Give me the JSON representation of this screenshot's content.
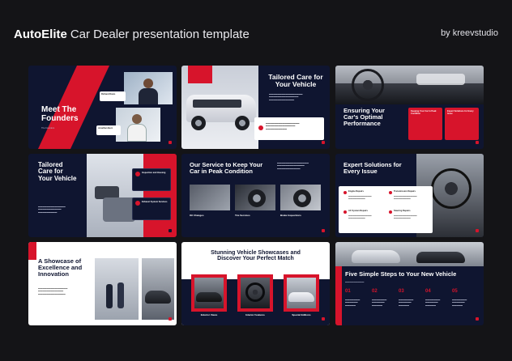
{
  "header": {
    "brand": "AutoElite",
    "subtitle": "Car Dealer presentation template",
    "credit": "by kreevstudio"
  },
  "slides": {
    "founders": {
      "title_line1": "Meet The",
      "title_line2": "Founders",
      "subtitle": "The Founders",
      "name1": "Richard Davis",
      "name2": "Jonathan Bern"
    },
    "tailored": {
      "title_line1": "Tailored Care for",
      "title_line2": "Your Vehicle"
    },
    "ensuring": {
      "title_line1": "Ensuring Your",
      "title_line2": "Car's Optimal",
      "title_line3": "Performance",
      "card1": "Keeping Your Car In Peak Condition",
      "card2": "Expert Solutions for Every Issue"
    },
    "tailored2": {
      "title_line1": "Tailored",
      "title_line2": "Care for",
      "title_line3": "Your Vehicle",
      "card1": "Inspection and Housing",
      "card2": "Exhaust System Services"
    },
    "service": {
      "title_line1": "Our Service to Keep Your",
      "title_line2": "Car in Peak Condition",
      "items": [
        "Oil Changes",
        "Tire Services",
        "Brake Inspections"
      ]
    },
    "expert": {
      "title_line1": "Expert Solutions for",
      "title_line2": "Every Issue",
      "items": [
        "Engine Repairs",
        "Transmission Repairs",
        "AC System Repairs",
        "Steering Repairs"
      ]
    },
    "showcase": {
      "title_line1": "A Showcase of",
      "title_line2": "Excellence and",
      "title_line3": "Innovation"
    },
    "stunning": {
      "title_line1": "Stunning Vehicle Showcases and",
      "title_line2": "Discover Your Perfect Match",
      "items": [
        "Exterior Views",
        "Interior Features",
        "Special Editions"
      ]
    },
    "steps": {
      "title": "Five Simple Steps to Your New Vehicle",
      "numbers": [
        "01",
        "02",
        "03",
        "04",
        "05"
      ]
    }
  }
}
